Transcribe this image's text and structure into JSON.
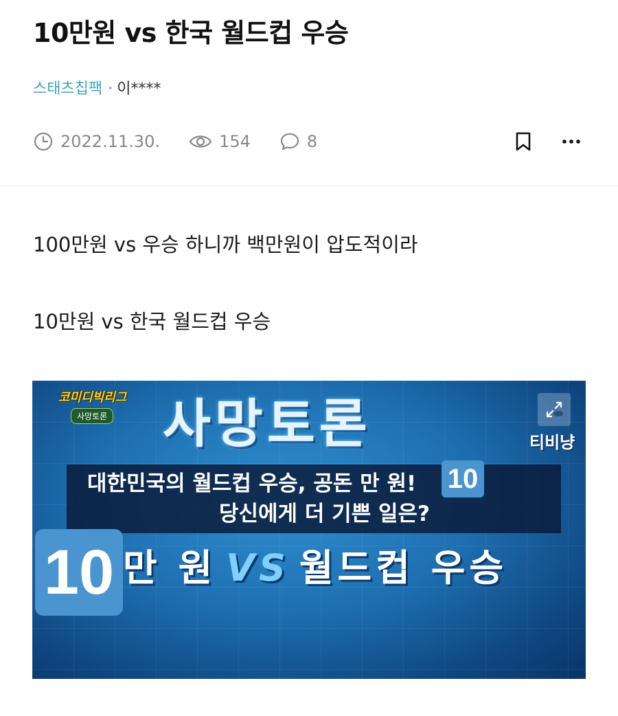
{
  "post": {
    "title": "10만원 vs 한국 월드컵 우승",
    "board": "스태츠칩팩",
    "separator": "·",
    "author": "이****",
    "date": "2022.11.30.",
    "views": "154",
    "comments": "8"
  },
  "icons": {
    "clock": "clock-icon",
    "eye": "eye-icon",
    "comment": "comment-icon",
    "bookmark": "bookmark-icon",
    "more": "more-icon"
  },
  "content": {
    "paragraph1": "100만원 vs 우승 하니까 백만원이 압도적이라",
    "paragraph2": "10만원 vs 한국 월드컵 우승"
  },
  "image": {
    "show_logo": "코미디빅리그",
    "show_segment": "사망토론",
    "heading": "사망토론",
    "channel": "티비냥",
    "subtitle_line1": "대한민국의 월드컵 우승, 공돈 만 원!",
    "subtitle_line2": "당신에게 더 기쁜 일은?",
    "small_badge": "10",
    "big_badge": "10",
    "option_left": "만 원",
    "option_vs": "VS",
    "option_right": "월드컵 우승"
  },
  "colors": {
    "board_link": "#3fa8b8",
    "meta_gray": "#888888",
    "badge_blue": "#4a94cf"
  }
}
